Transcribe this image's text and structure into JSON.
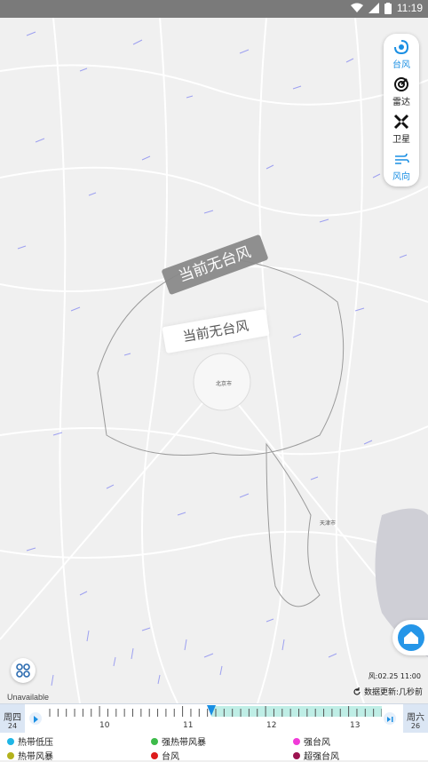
{
  "status": {
    "time": "11:19"
  },
  "layers": [
    {
      "label": "台风",
      "icon": "typhoon-icon",
      "active": true
    },
    {
      "label": "雷达",
      "icon": "radar-icon",
      "active": false
    },
    {
      "label": "卫星",
      "icon": "satellite-icon",
      "active": false
    },
    {
      "label": "风向",
      "icon": "wind-icon",
      "active": true
    }
  ],
  "map": {
    "notice_tilted": "当前无台风",
    "notice_flat": "当前无台风",
    "city_beijing": "北京市",
    "city_tianjin": "天津市",
    "attribution": "Unavailable",
    "wind_time": "风:02.25 11:00",
    "update_note": "数据更新:几秒前"
  },
  "timeline": {
    "left_day": "周四",
    "left_date": "24",
    "right_day": "周六",
    "right_date": "26",
    "hours": [
      "10",
      "11",
      "12",
      "13"
    ],
    "progress": 0.49
  },
  "legend": [
    {
      "label": "热带低压",
      "color": "#1fb6e6"
    },
    {
      "label": "强热带风暴",
      "color": "#3dbb4a"
    },
    {
      "label": "强台风",
      "color": "#f13bd8"
    },
    {
      "label": "热带风暴",
      "color": "#b3b21c"
    },
    {
      "label": "台风",
      "color": "#dd1c1c"
    },
    {
      "label": "超强台风",
      "color": "#9c1450"
    }
  ]
}
